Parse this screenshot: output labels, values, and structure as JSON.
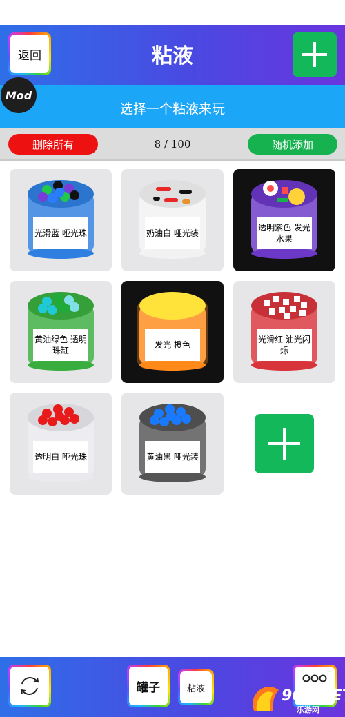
{
  "header": {
    "back_label": "返回",
    "title": "粘液",
    "add_icon": "plus-icon"
  },
  "mod_badge": "Mod",
  "banner": {
    "text": "选择一个粘液来玩"
  },
  "actions": {
    "delete_all": "删除所有",
    "count": "8 / 100",
    "random_add": "随机添加"
  },
  "slimes": [
    {
      "label": "光滑蓝 哑光珠",
      "jar_color": "#2f7fe0",
      "topping": "balls",
      "topping_colors": [
        "#21c94a",
        "#111111",
        "#7a3bd6",
        "#2a7dff"
      ],
      "dark": false
    },
    {
      "label": "奶油白 哑光装",
      "jar_color": "#f2f2f2",
      "topping": "sticks",
      "topping_colors": [
        "#e82828",
        "#111111",
        "#e8902a"
      ],
      "dark": false
    },
    {
      "label": "透明紫色 发光水果",
      "jar_color": "#6b38c7",
      "topping": "fruit",
      "topping_colors": [
        "#ff4b4b",
        "#ffd23a",
        "#ffffff",
        "#17b24d"
      ],
      "dark": true
    },
    {
      "label": "黄油绿色 透明珠缸",
      "jar_color": "#3aad3f",
      "topping": "balls",
      "topping_colors": [
        "#1fc9d6",
        "#1faa3a",
        "#7fe0e8"
      ],
      "dark": false
    },
    {
      "label": "发光 橙色",
      "jar_color": "#ff8a1a",
      "topping": "glow",
      "topping_colors": [
        "#ffd21a"
      ],
      "dark": true
    },
    {
      "label": "光滑红 油光闪烁",
      "jar_color": "#d8353b",
      "topping": "squares",
      "topping_colors": [
        "#ffffff"
      ],
      "dark": false
    },
    {
      "label": "透明白 哑光珠",
      "jar_color": "#e9e9ee",
      "topping": "balls",
      "topping_colors": [
        "#e81a1a"
      ],
      "dark": false
    },
    {
      "label": "黄油黑 哑光装",
      "jar_color": "#555555",
      "topping": "balls",
      "topping_colors": [
        "#1a7aff"
      ],
      "dark": false
    }
  ],
  "footer": {
    "jars_label": "罐子",
    "slime_label": "粘液",
    "refresh_icon": "refresh-icon",
    "more_icon": "more-icon"
  },
  "watermark": {
    "brand": "962.NET",
    "sub": "乐游网"
  }
}
